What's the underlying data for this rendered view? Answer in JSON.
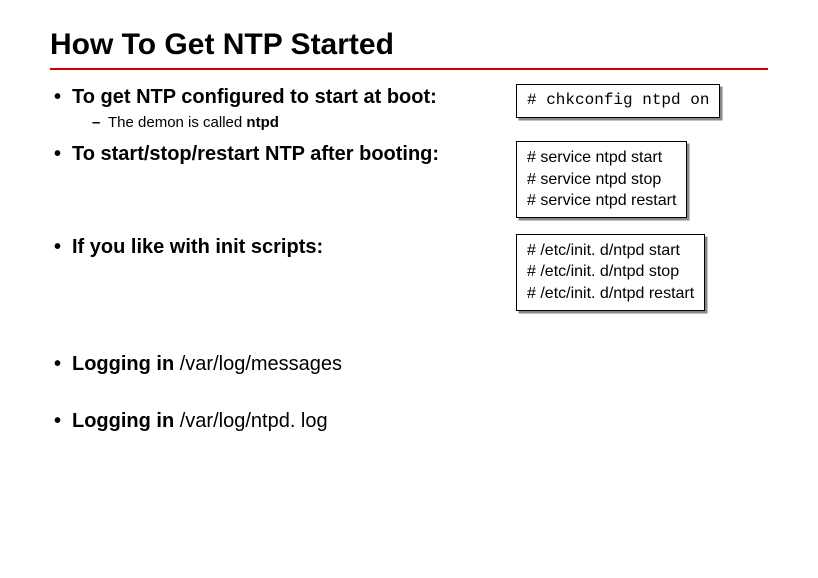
{
  "title": "How To Get NTP Started",
  "bullets": {
    "b1": {
      "text": "To get NTP configured to start at boot:"
    },
    "b1sub": {
      "prefix": "The demon is called ",
      "bold": "ntpd"
    },
    "b2": {
      "text": "To start/stop/restart NTP after booting:"
    },
    "b3": {
      "text": "If you like with init scripts:"
    },
    "b4": {
      "bold": "Logging in ",
      "norm": "/var/log/messages"
    },
    "b5": {
      "bold": "Logging in ",
      "norm": "/var/log/ntpd. log"
    }
  },
  "code": {
    "box1": {
      "l1": "# chkconfig ntpd on"
    },
    "box2": {
      "l1": "# service ntpd start",
      "l2": "# service ntpd stop",
      "l3": "# service ntpd restart"
    },
    "box3": {
      "l1": "# /etc/init. d/ntpd start",
      "l2": "# /etc/init. d/ntpd stop",
      "l3": "# /etc/init. d/ntpd restart"
    }
  }
}
